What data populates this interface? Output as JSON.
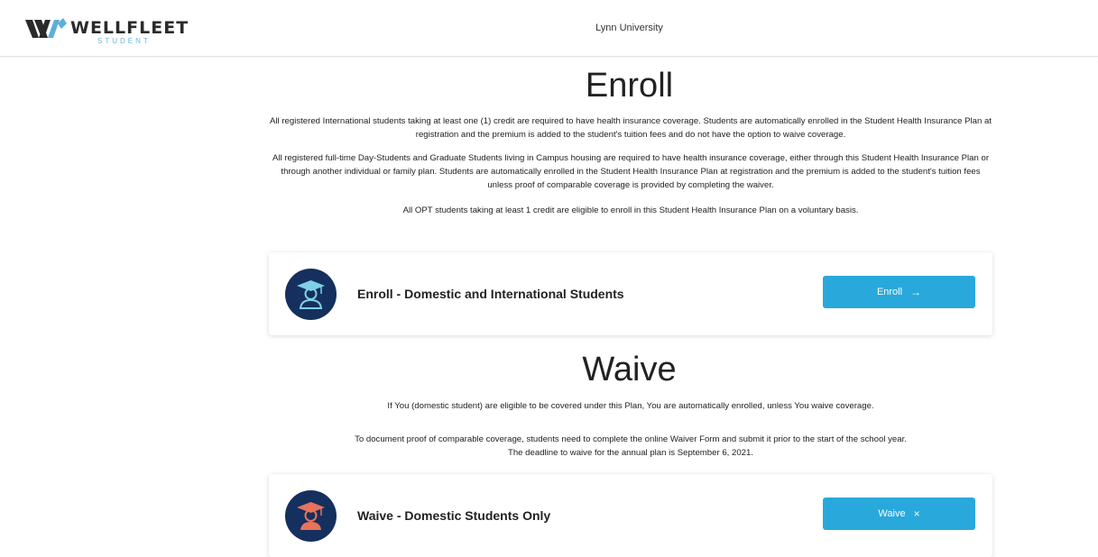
{
  "header": {
    "brand": "WELLFLEET",
    "brand_sub": "STUDENT",
    "school": "Lynn University"
  },
  "enroll": {
    "title": "Enroll",
    "paragraphs": [
      "All registered International students taking at least one (1) credit are required to have health insurance coverage. Students are automatically enrolled in the Student Health Insurance Plan at registration and the premium is added to the student's tuition fees and do not have the option to waive coverage.",
      "All registered full-time Day-Students and Graduate Students living in Campus housing are required to have health insurance coverage, either through this Student Health Insurance Plan or through another individual or family plan. Students are automatically enrolled in the Student Health Insurance Plan at registration and the premium is added to the student's tuition fees unless proof of comparable coverage is provided by completing the waiver.",
      "All OPT students taking at least 1 credit are eligible to enroll in this Student Health Insurance Plan on a voluntary basis."
    ],
    "card_label": "Enroll - Domestic and International Students",
    "button_label": "Enroll",
    "button_icon": "→"
  },
  "waive": {
    "title": "Waive",
    "paragraphs": [
      "If You (domestic student) are eligible to be covered under this Plan, You are automatically enrolled, unless You waive coverage.",
      "To document proof of comparable coverage, students need to complete the online Waiver Form and submit it prior to the start of the school year.",
      "The deadline to waive for the annual plan is September 6, 2021."
    ],
    "card_label": "Waive - Domestic Students Only",
    "button_label": "Waive",
    "button_icon": "×"
  },
  "colors": {
    "accent": "#29a8dc",
    "avatar_bg": "#15305e",
    "enroll_figure": "#7fd0e6",
    "waive_figure": "#e8735a"
  }
}
